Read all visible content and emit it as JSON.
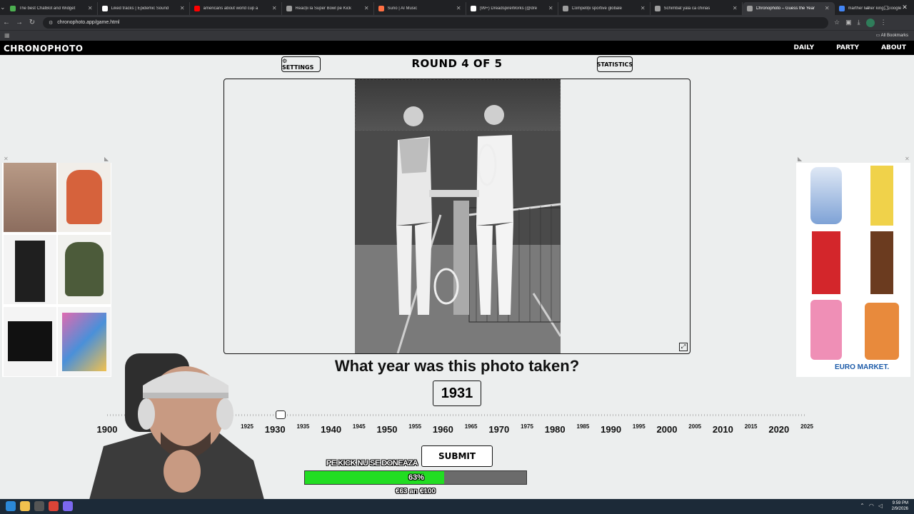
{
  "browser": {
    "tabs": [
      {
        "title": "The best ChatBot and Widget",
        "color": "#4caf50"
      },
      {
        "title": "Liked tracks | Epidemic Sound",
        "color": "#ffffff"
      },
      {
        "title": "americans about world cup a",
        "color": "#ff0000"
      },
      {
        "title": "Reacții la Super Bowl pe Kick",
        "color": "#9e9e9e"
      },
      {
        "title": "Suno | AI Music",
        "color": "#ff7043"
      },
      {
        "title": "(99+) DreadspireWorks (@dre",
        "color": "#ffffff"
      },
      {
        "title": "Competiții sportive globale",
        "color": "#9e9e9e"
      },
      {
        "title": "Schimbat yala ca chirias",
        "color": "#9e9e9e"
      },
      {
        "title": "Chronophoto – Guess the Year",
        "color": "#9e9e9e",
        "active": true
      },
      {
        "title": "marther luther king - Google",
        "color": "#4285f4"
      }
    ],
    "url": "chronophoto.app/game.html",
    "bookmarks_label": "All Bookmarks",
    "window_controls": [
      "–",
      "□",
      "✕"
    ]
  },
  "site": {
    "logo": "CHRONOPHOTO",
    "nav": [
      "DAILY",
      "PARTY",
      "ABOUT"
    ]
  },
  "game": {
    "settings_label": "⚙ SETTINGS",
    "round_label": "ROUND 4 OF 5",
    "stats_label": "STATISTICS",
    "question": "What year was this photo taken?",
    "guess_year": "1931",
    "submit_label": "SUBMIT",
    "slider": {
      "min": 1900,
      "max": 2025,
      "value": 1931,
      "major_ticks": [
        "1900",
        "1930",
        "1940",
        "1950",
        "1960",
        "1970",
        "1980",
        "1990",
        "2000",
        "2010",
        "2020"
      ],
      "minor_ticks": [
        "1925",
        "1935",
        "1945",
        "1955",
        "1965",
        "1975",
        "1985",
        "1995",
        "2005",
        "2015",
        "2025"
      ]
    }
  },
  "ads": {
    "brand": "EURO MARKET."
  },
  "overlay": {
    "donation_label": "PE KICK NU SE DONEAZA",
    "progress_percent": 63,
    "progress_label": "63%",
    "amount_label": "€63 an €100"
  },
  "taskbar": {
    "time": "9:59 PM",
    "date": "2/9/2026"
  },
  "colors": {
    "accent_green": "#22dd22",
    "header_bg": "#000000",
    "page_bg": "#eceeee"
  }
}
